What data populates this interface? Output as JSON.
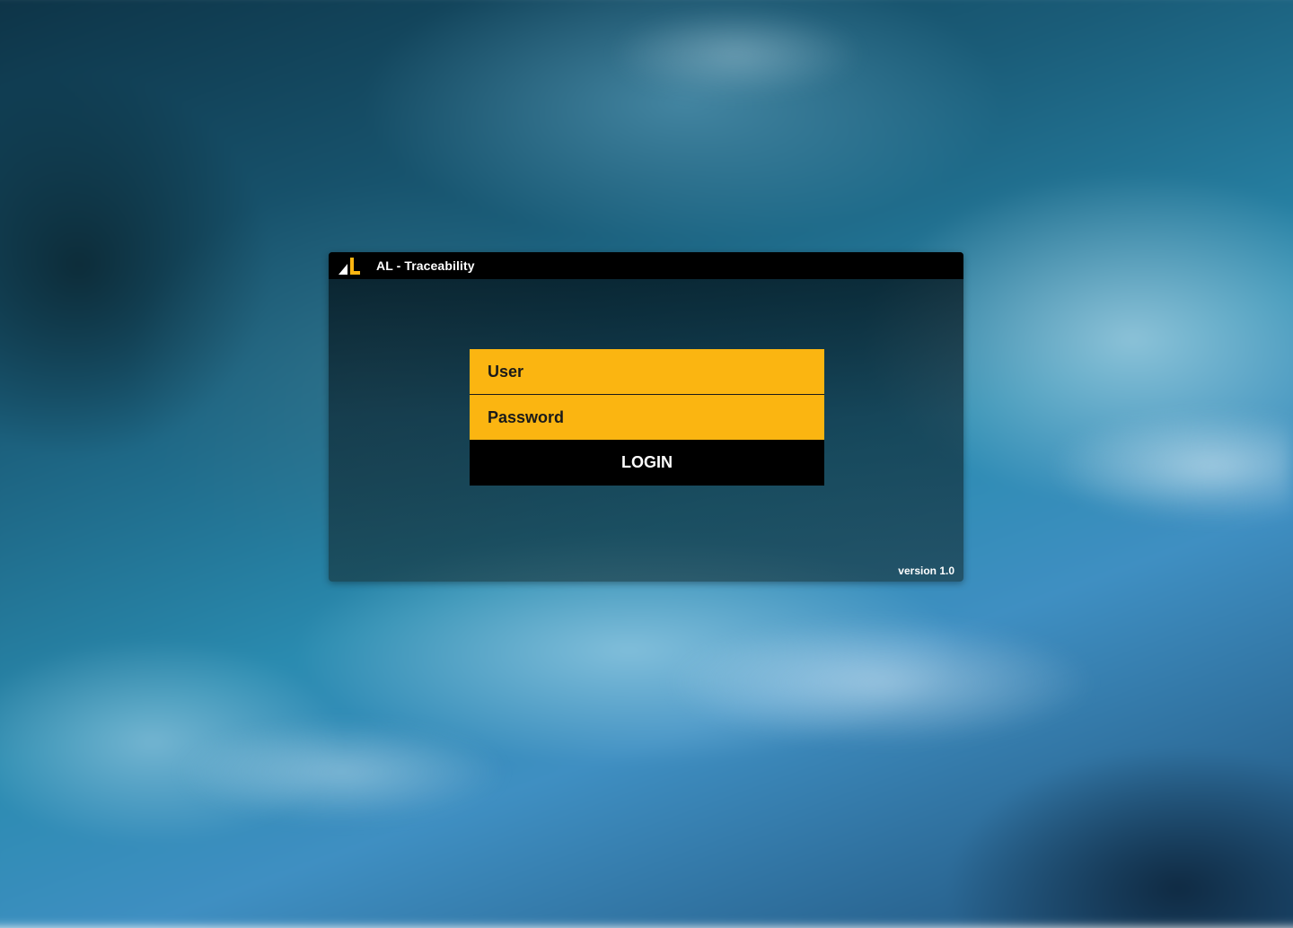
{
  "app": {
    "title": "AL - Traceability",
    "logo_icon": "al-logo-icon",
    "version": "version 1.0"
  },
  "login": {
    "user_placeholder": "User",
    "password_placeholder": "Password",
    "button_label": "LOGIN"
  },
  "colors": {
    "accent": "#fbb511",
    "titlebar": "#000000",
    "button": "#000000"
  }
}
